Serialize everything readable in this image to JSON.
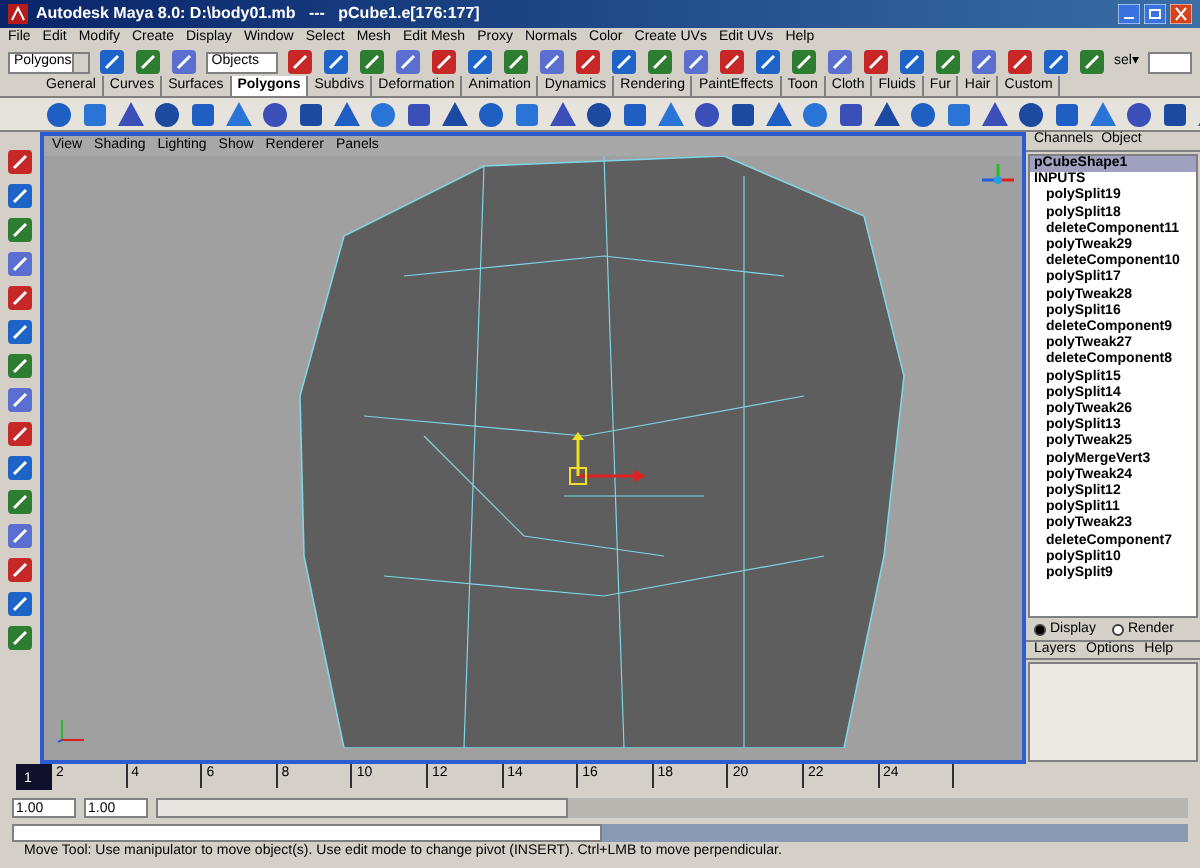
{
  "window": {
    "title": "Autodesk Maya 8.0: D:\\body01.mb   ---   pCube1.e[176:177]"
  },
  "menu": [
    "File",
    "Edit",
    "Modify",
    "Create",
    "Display",
    "Window",
    "Select",
    "Mesh",
    "Edit Mesh",
    "Proxy",
    "Normals",
    "Color",
    "Create UVs",
    "Edit UVs",
    "Help"
  ],
  "toolbar": {
    "mode": "Polygons",
    "selection_field": "Objects",
    "sel_label": "sel▾"
  },
  "shelf_tabs": [
    {
      "label": "General",
      "selected": false
    },
    {
      "label": "Curves",
      "selected": false
    },
    {
      "label": "Surfaces",
      "selected": false
    },
    {
      "label": "Polygons",
      "selected": true
    },
    {
      "label": "Subdivs",
      "selected": false
    },
    {
      "label": "Deformation",
      "selected": false
    },
    {
      "label": "Animation",
      "selected": false
    },
    {
      "label": "Dynamics",
      "selected": false
    },
    {
      "label": "Rendering",
      "selected": false
    },
    {
      "label": "PaintEffects",
      "selected": false
    },
    {
      "label": "Toon",
      "selected": false
    },
    {
      "label": "Cloth",
      "selected": false
    },
    {
      "label": "Fluids",
      "selected": false
    },
    {
      "label": "Fur",
      "selected": false
    },
    {
      "label": "Hair",
      "selected": false
    },
    {
      "label": "Custom",
      "selected": false
    }
  ],
  "panel_menu": [
    "View",
    "Shading",
    "Lighting",
    "Show",
    "Renderer",
    "Panels"
  ],
  "channel_box": {
    "tabs": [
      "Channels",
      "Object"
    ],
    "items": [
      {
        "label": "pCubeShape1",
        "selected": true,
        "kind": "node"
      },
      {
        "label": "INPUTS",
        "selected": false,
        "kind": "header"
      },
      {
        "label": "polySplit19",
        "selected": false,
        "kind": "input"
      },
      {
        "label": "polySplit18",
        "selected": false,
        "kind": "input"
      },
      {
        "label": "deleteComponent11",
        "selected": false,
        "kind": "input"
      },
      {
        "label": "polyTweak29",
        "selected": false,
        "kind": "input"
      },
      {
        "label": "deleteComponent10",
        "selected": false,
        "kind": "input"
      },
      {
        "label": "polySplit17",
        "selected": false,
        "kind": "input"
      },
      {
        "label": "polyTweak28",
        "selected": false,
        "kind": "input"
      },
      {
        "label": "polySplit16",
        "selected": false,
        "kind": "input"
      },
      {
        "label": "deleteComponent9",
        "selected": false,
        "kind": "input"
      },
      {
        "label": "polyTweak27",
        "selected": false,
        "kind": "input"
      },
      {
        "label": "deleteComponent8",
        "selected": false,
        "kind": "input"
      },
      {
        "label": "polySplit15",
        "selected": false,
        "kind": "input"
      },
      {
        "label": "polySplit14",
        "selected": false,
        "kind": "input"
      },
      {
        "label": "polyTweak26",
        "selected": false,
        "kind": "input"
      },
      {
        "label": "polySplit13",
        "selected": false,
        "kind": "input"
      },
      {
        "label": "polyTweak25",
        "selected": false,
        "kind": "input"
      },
      {
        "label": "polyMergeVert3",
        "selected": false,
        "kind": "input"
      },
      {
        "label": "polyTweak24",
        "selected": false,
        "kind": "input"
      },
      {
        "label": "polySplit12",
        "selected": false,
        "kind": "input"
      },
      {
        "label": "polySplit11",
        "selected": false,
        "kind": "input"
      },
      {
        "label": "polyTweak23",
        "selected": false,
        "kind": "input"
      },
      {
        "label": "deleteComponent7",
        "selected": false,
        "kind": "input"
      },
      {
        "label": "polySplit10",
        "selected": false,
        "kind": "input"
      },
      {
        "label": "polySplit9",
        "selected": false,
        "kind": "input"
      }
    ]
  },
  "layers": {
    "options": [
      {
        "label": "Display",
        "selected": true
      },
      {
        "label": "Render",
        "selected": false
      }
    ],
    "menu": [
      "Layers",
      "Options",
      "Help"
    ]
  },
  "timeline": {
    "current_frame": "1",
    "ticks": [
      "2",
      "4",
      "6",
      "8",
      "10",
      "12",
      "14",
      "16",
      "18",
      "20",
      "22",
      "24"
    ]
  },
  "range": {
    "start": "1.00",
    "playback_start": "1.00",
    "level": 0.4
  },
  "help_line": "Move Tool: Use manipulator to move object(s). Use edit mode to change pivot (INSERT). Ctrl+LMB to move perpendicular."
}
